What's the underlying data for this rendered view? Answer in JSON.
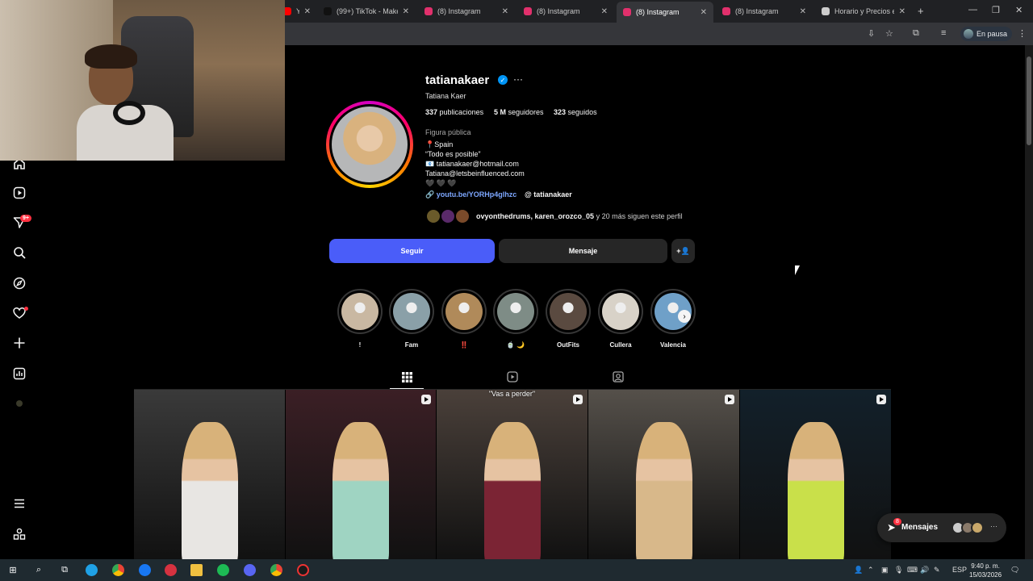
{
  "browser": {
    "tabs": [
      {
        "title": "Y La",
        "favicon_color": "#ff0000"
      },
      {
        "title": "(99+) TikTok - Make Y",
        "favicon_color": "#111111"
      },
      {
        "title": "(8) Instagram",
        "favicon_color": "#e1306c"
      },
      {
        "title": "(8) Instagram",
        "favicon_color": "#e1306c"
      },
      {
        "title": "(8) Instagram",
        "favicon_color": "#e1306c",
        "active": true
      },
      {
        "title": "(8) Instagram",
        "favicon_color": "#e1306c"
      },
      {
        "title": "Horario y Precios en",
        "favicon_color": "#cccccc"
      }
    ],
    "new_tab_glyph": "+",
    "profile_status": "En pausa"
  },
  "nav": {
    "notifications_badge": "9+"
  },
  "profile": {
    "username": "tatianakaer",
    "full_name": "Tatiana Kaer",
    "stats": {
      "posts_count": "337",
      "posts_label": "publicaciones",
      "followers_count": "5 M",
      "followers_label": "seguidores",
      "following_count": "323",
      "following_label": "seguidos"
    },
    "category": "Figura pública",
    "bio": [
      "📍Spain",
      "“Todo es posible”",
      "📧 tatianakaer@hotmail.com",
      "Tatiana@letsbeinfluenced.com",
      "🖤 🖤 🖤"
    ],
    "link": "youtu.be/YORHp4glhzc",
    "threads_handle": "tatianakaer",
    "followed_by_names": "ovyonthedrums, karen_orozco_05",
    "followed_by_rest": " y 20 más siguen este perfil",
    "follow_button": "Seguir",
    "message_button": "Mensaje",
    "add_person_glyph": "+👤"
  },
  "highlights": [
    {
      "label": "!",
      "color": "#c9b8a2"
    },
    {
      "label": "Fam",
      "color": "#8aa0a8"
    },
    {
      "label": "‼️",
      "color": "#b08a5a"
    },
    {
      "label": "🍵 🌙",
      "color": "#7e8c86"
    },
    {
      "label": "OutFits",
      "color": "#5a4a40"
    },
    {
      "label": "Cullera",
      "color": "#d8d2c8"
    },
    {
      "label": "Valencia",
      "color": "#6fa0c8"
    }
  ],
  "posts": [
    {
      "caption": "",
      "reel": false,
      "bg": "#3a3a3a",
      "accent": "#e8e6e3"
    },
    {
      "caption": "",
      "reel": true,
      "bg": "#3b1f25",
      "accent": "#9fd4c2"
    },
    {
      "caption": "\"Vas a perder\"",
      "reel": true,
      "bg": "#4a403a",
      "accent": "#7b2434"
    },
    {
      "caption": "",
      "reel": true,
      "bg": "#55504a",
      "accent": "#d8b88a"
    },
    {
      "caption": "",
      "reel": true,
      "bg": "#12202a",
      "accent": "#c9e04a"
    }
  ],
  "messages_pill": {
    "label": "Mensajes",
    "badge": "8",
    "more_glyph": "···"
  },
  "taskbar": {
    "language": "ESP",
    "time": "9:40 p. m.",
    "date": "15/03/2026"
  },
  "colors": {
    "primary_blue": "#4a5df9",
    "link_blue": "#7da7ff",
    "verified_blue": "#0095f6",
    "badge_red": "#ff3040",
    "page_bg": "#000000"
  }
}
